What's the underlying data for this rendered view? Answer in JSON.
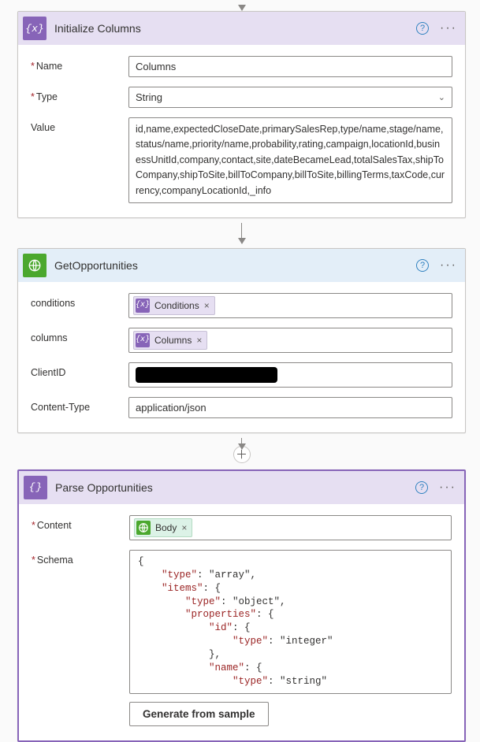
{
  "card1": {
    "title": "Initialize Columns",
    "name_label": "Name",
    "name_value": "Columns",
    "type_label": "Type",
    "type_value": "String",
    "value_label": "Value",
    "value_text": "id,name,expectedCloseDate,primarySalesRep,type/name,stage/name,status/name,priority/name,probability,rating,campaign,locationId,businessUnitId,company,contact,site,dateBecameLead,totalSalesTax,shipToCompany,shipToSite,billToCompany,billToSite,billingTerms,taxCode,currency,companyLocationId,_info"
  },
  "card2": {
    "title": "GetOpportunities",
    "conditions_label": "conditions",
    "conditions_token": "Conditions",
    "columns_label": "columns",
    "columns_token": "Columns",
    "clientid_label": "ClientID",
    "contenttype_label": "Content-Type",
    "contenttype_value": "application/json"
  },
  "card3": {
    "title": "Parse Opportunities",
    "content_label": "Content",
    "content_token": "Body",
    "schema_label": "Schema",
    "schema_lines": [
      "{",
      "    \"type\": \"array\",",
      "    \"items\": {",
      "        \"type\": \"object\",",
      "        \"properties\": {",
      "            \"id\": {",
      "                \"type\": \"integer\"",
      "            },",
      "            \"name\": {",
      "                \"type\": \"string\""
    ],
    "generate_btn": "Generate from sample"
  }
}
